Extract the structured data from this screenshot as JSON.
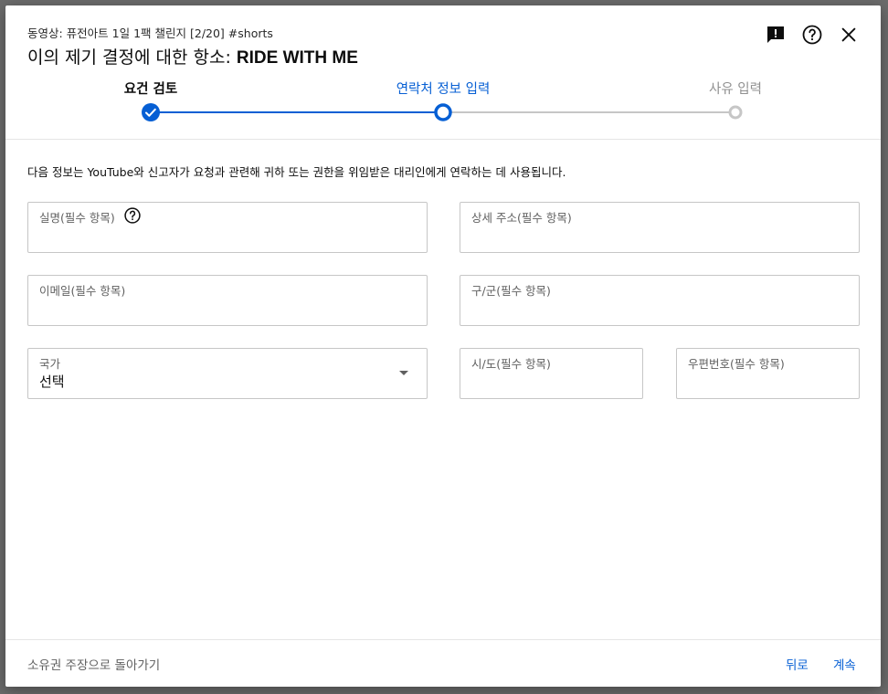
{
  "header": {
    "video_line": "동영상: 퓨전아트 1일 1팩 챌린지 [2/20] #shorts",
    "title_prefix": "이의 제기 결정에 대한 항소: ",
    "title_video": "RIDE WITH ME"
  },
  "icons": {
    "feedback": "feedback-icon",
    "help": "help-icon",
    "close": "close-icon"
  },
  "stepper": {
    "steps": [
      {
        "label": "요건 검토",
        "state": "done"
      },
      {
        "label": "연락처 정보 입력",
        "state": "current"
      },
      {
        "label": "사유 입력",
        "state": "upcoming"
      }
    ],
    "colors": {
      "active": "#065fd4",
      "inactive": "#c6c6c6"
    }
  },
  "info_text": "다음 정보는 YouTube와 신고자가 요청과 관련해 귀하 또는 권한을 위임받은 대리인에게 연락하는 데 사용됩니다.",
  "form": {
    "name": {
      "label": "실명(필수 항목)",
      "value": ""
    },
    "email": {
      "label": "이메일(필수 항목)",
      "value": ""
    },
    "country": {
      "label": "국가",
      "value": "선택"
    },
    "address": {
      "label": "상세 주소(필수 항목)",
      "value": ""
    },
    "district": {
      "label": "구/군(필수 항목)",
      "value": ""
    },
    "city": {
      "label": "시/도(필수 항목)",
      "value": ""
    },
    "postal": {
      "label": "우편번호(필수 항목)",
      "value": ""
    }
  },
  "footer": {
    "back_link": "소유권 주장으로 돌아가기",
    "prev_button": "뒤로",
    "next_button": "계속"
  }
}
